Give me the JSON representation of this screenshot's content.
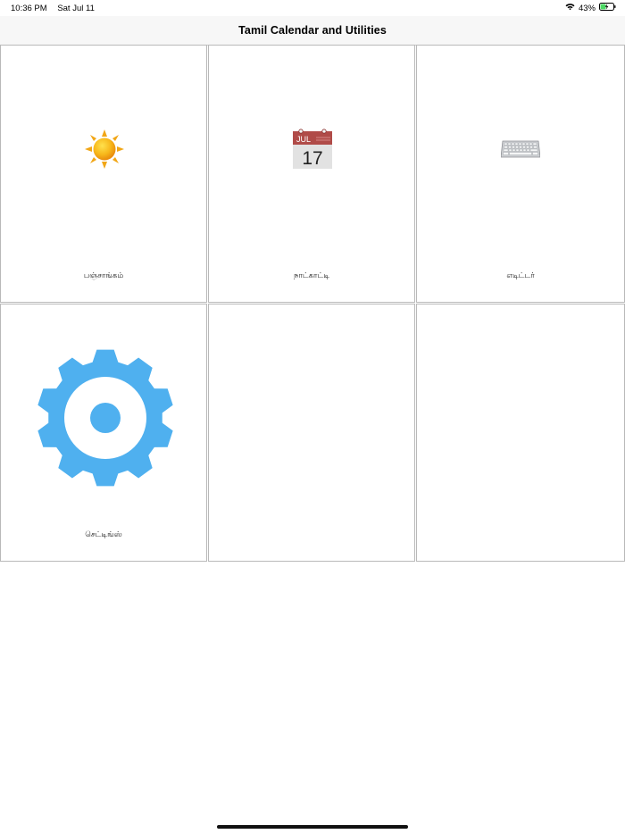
{
  "status_bar": {
    "time": "10:36 PM",
    "date": "Sat Jul 11",
    "battery_percent": "43%",
    "wifi_icon": "wifi-icon",
    "battery_icon": "battery-charging-icon",
    "battery_level": 0.43
  },
  "nav": {
    "title": "Tamil Calendar and Utilities"
  },
  "tiles": [
    {
      "label": "பஞ்சாங்கம்",
      "icon": "sun-icon"
    },
    {
      "label": "நாட்காட்டி",
      "icon": "calendar-icon",
      "calendar_month": "JUL",
      "calendar_day": "17"
    },
    {
      "label": "எடிட்டர்",
      "icon": "keyboard-icon"
    },
    {
      "label": "செட்டிங்ஸ்",
      "icon": "gear-icon"
    },
    {
      "label": "",
      "icon": ""
    },
    {
      "label": "",
      "icon": ""
    }
  ],
  "colors": {
    "gear": "#4fb0ef",
    "calendar_header": "#b04b48",
    "sun": "#f5b417",
    "battery_fill": "#4cd964"
  }
}
